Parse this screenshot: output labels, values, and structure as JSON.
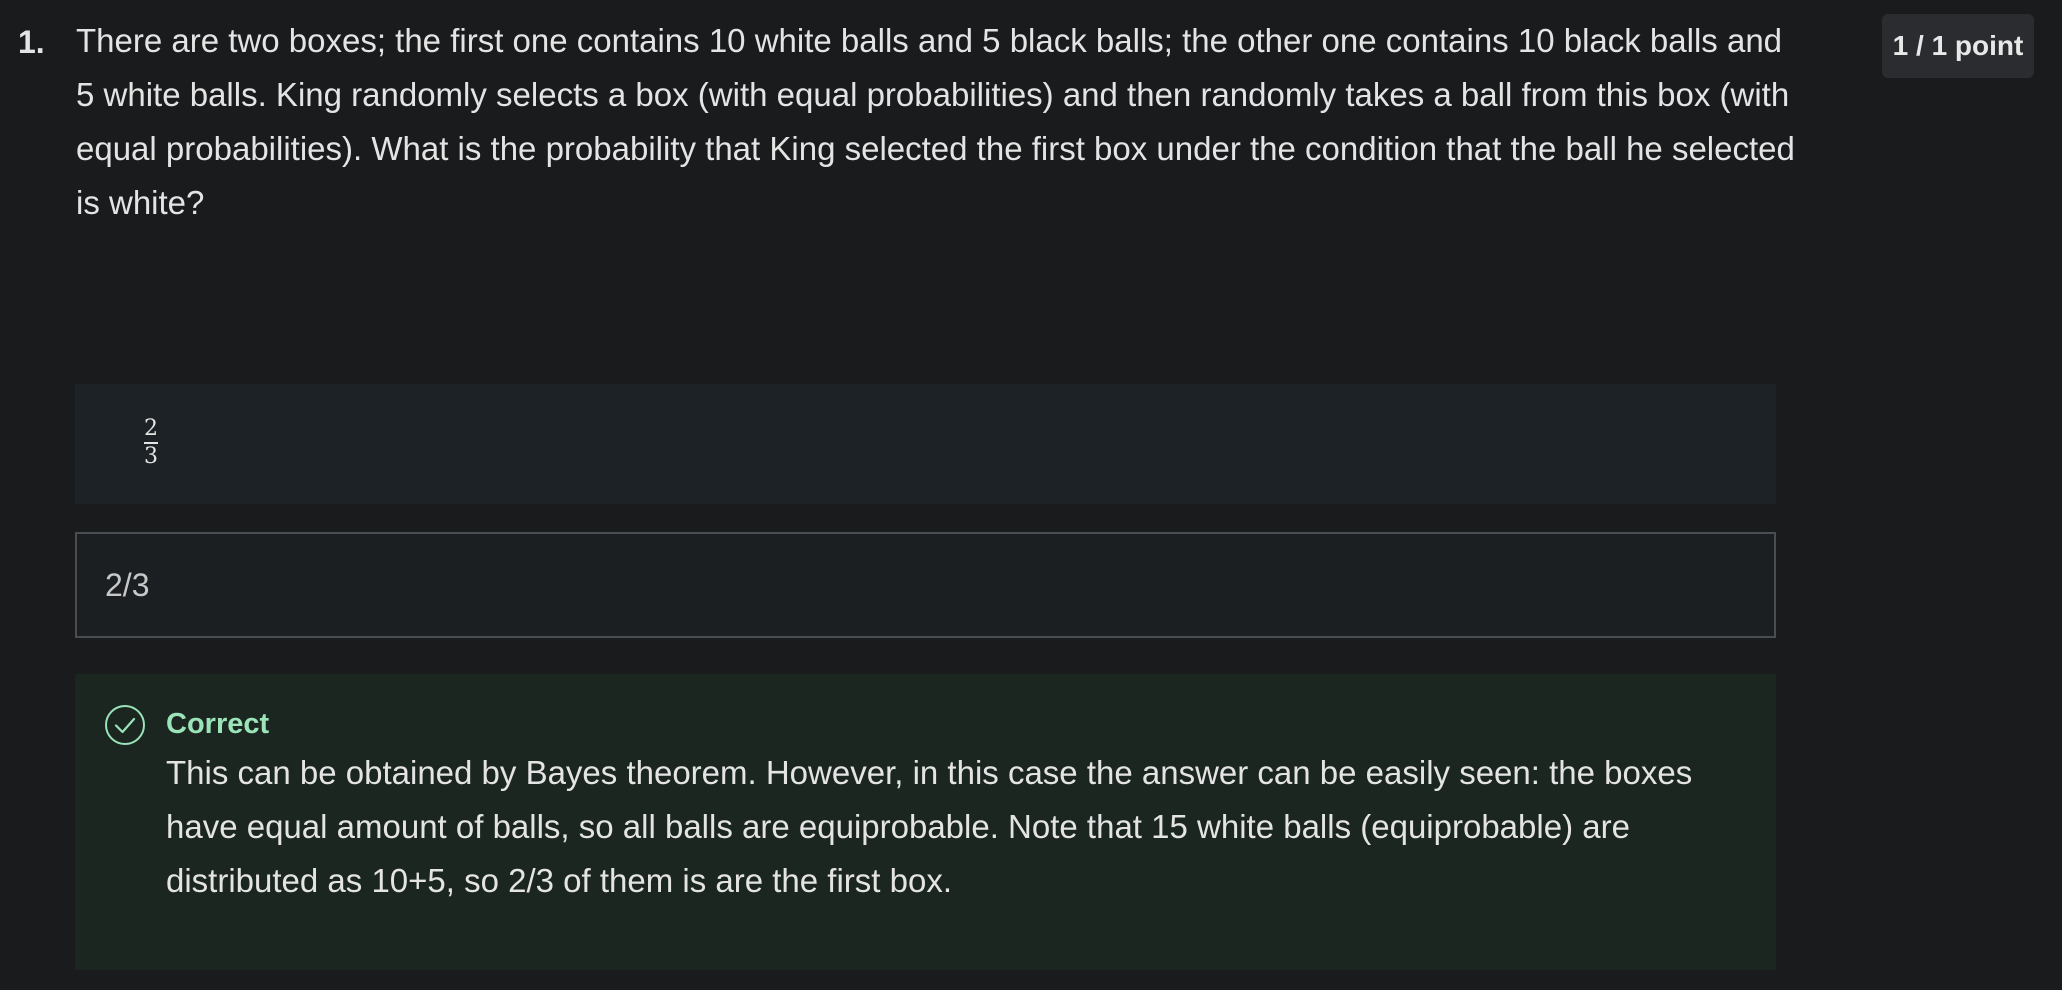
{
  "question": {
    "number": "1.",
    "text": "There are two boxes; the first one contains 10 white balls and 5 black balls; the other one contains 10 black balls and 5 white balls. King randomly selects a box (with equal probabilities) and then randomly takes a ball from this box (with equal probabilities). What  is the probability that King selected the first box under the condition that the ball he selected is white?",
    "points": "1 / 1 point"
  },
  "prompt": {
    "numerator": "2",
    "denominator": "3"
  },
  "answer": {
    "value": "2/3"
  },
  "feedback": {
    "status": "Correct",
    "text": "This can be obtained by Bayes theorem. However, in this case the answer can be easily seen: the boxes have equal amount of balls, so all balls are equiprobable. Note that 15 white balls (equiprobable) are distributed as 10+5, so 2/3 of them is are the first box.",
    "icon": "check-circle-icon",
    "color": "#9be3b8"
  }
}
